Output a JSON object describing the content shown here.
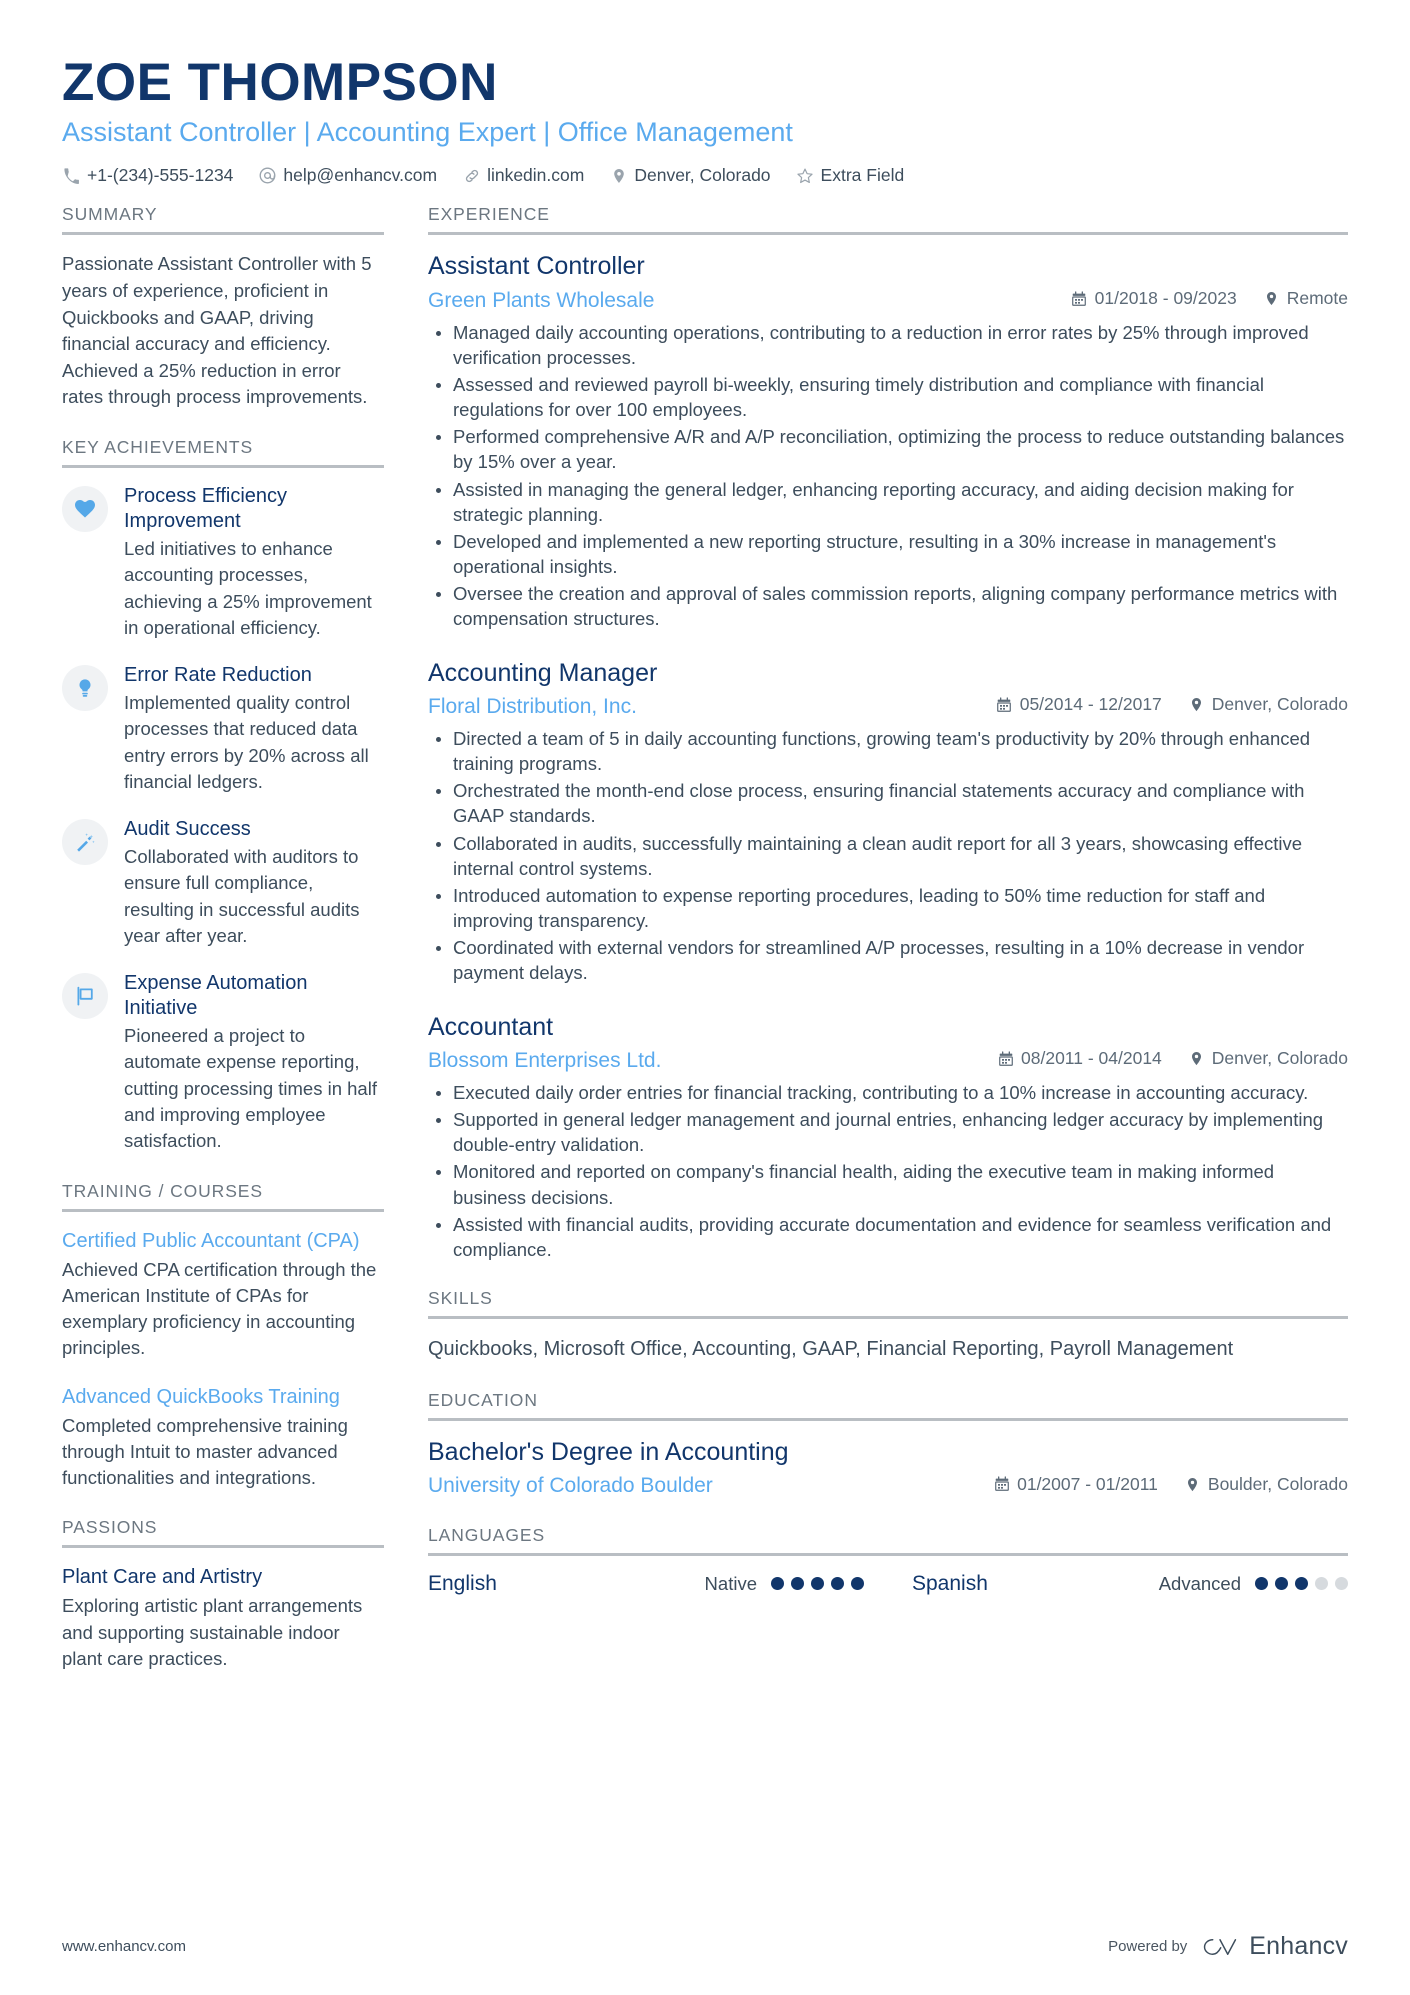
{
  "header": {
    "name": "ZOE THOMPSON",
    "headline": "Assistant Controller | Accounting Expert | Office Management",
    "contacts": [
      {
        "icon": "phone-icon",
        "text": "+1-(234)-555-1234"
      },
      {
        "icon": "email-icon",
        "text": "help@enhancv.com"
      },
      {
        "icon": "link-icon",
        "text": "linkedin.com"
      },
      {
        "icon": "location-pin-icon",
        "text": "Denver, Colorado"
      },
      {
        "icon": "star-icon",
        "text": "Extra Field"
      }
    ]
  },
  "sidebar": {
    "summary": {
      "title": "SUMMARY",
      "text": "Passionate Assistant Controller with 5 years of experience, proficient in Quickbooks and GAAP, driving financial accuracy and efficiency. Achieved a 25% reduction in error rates through process improvements."
    },
    "key_achievements": {
      "title": "KEY ACHIEVEMENTS",
      "items": [
        {
          "icon": "heart-icon",
          "title": "Process Efficiency Improvement",
          "desc": "Led initiatives to enhance accounting processes, achieving a 25% improvement in operational efficiency."
        },
        {
          "icon": "lightbulb-icon",
          "title": "Error Rate Reduction",
          "desc": "Implemented quality control processes that reduced data entry errors by 20% across all financial ledgers."
        },
        {
          "icon": "magic-wand-icon",
          "title": "Audit Success",
          "desc": "Collaborated with auditors to ensure full compliance, resulting in successful audits year after year."
        },
        {
          "icon": "flag-icon",
          "title": "Expense Automation Initiative",
          "desc": "Pioneered a project to automate expense reporting, cutting processing times in half and improving employee satisfaction."
        }
      ]
    },
    "training": {
      "title": "TRAINING / COURSES",
      "items": [
        {
          "title": "Certified Public Accountant (CPA)",
          "desc": "Achieved CPA certification through the American Institute of CPAs for exemplary proficiency in accounting principles."
        },
        {
          "title": "Advanced QuickBooks Training",
          "desc": "Completed comprehensive training through Intuit to master advanced functionalities and integrations."
        }
      ]
    },
    "passions": {
      "title": "PASSIONS",
      "items": [
        {
          "title": "Plant Care and Artistry",
          "desc": "Exploring artistic plant arrangements and supporting sustainable indoor plant care practices."
        }
      ]
    }
  },
  "main": {
    "experience": {
      "title": "EXPERIENCE",
      "jobs": [
        {
          "title": "Assistant Controller",
          "company": "Green Plants Wholesale",
          "dates": "01/2018 - 09/2023",
          "location": "Remote",
          "bullets": [
            "Managed daily accounting operations, contributing to a reduction in error rates by 25% through improved verification processes.",
            "Assessed and reviewed payroll bi-weekly, ensuring timely distribution and compliance with financial regulations for over 100 employees.",
            "Performed comprehensive A/R and A/P reconciliation, optimizing the process to reduce outstanding balances by 15% over a year.",
            "Assisted in managing the general ledger, enhancing reporting accuracy, and aiding decision making for strategic planning.",
            "Developed and implemented a new reporting structure, resulting in a 30% increase in management's operational insights.",
            "Oversee the creation and approval of sales commission reports, aligning company performance metrics with compensation structures."
          ]
        },
        {
          "title": "Accounting Manager",
          "company": "Floral Distribution, Inc.",
          "dates": "05/2014 - 12/2017",
          "location": "Denver, Colorado",
          "bullets": [
            "Directed a team of 5 in daily accounting functions, growing team's productivity by 20% through enhanced training programs.",
            "Orchestrated the month-end close process, ensuring financial statements accuracy and compliance with GAAP standards.",
            "Collaborated in audits, successfully maintaining a clean audit report for all 3 years, showcasing effective internal control systems.",
            "Introduced automation to expense reporting procedures, leading to 50% time reduction for staff and improving transparency.",
            "Coordinated with external vendors for streamlined A/P processes, resulting in a 10% decrease in vendor payment delays."
          ]
        },
        {
          "title": "Accountant",
          "company": "Blossom Enterprises Ltd.",
          "dates": "08/2011 - 04/2014",
          "location": "Denver, Colorado",
          "bullets": [
            "Executed daily order entries for financial tracking, contributing to a 10% increase in accounting accuracy.",
            "Supported in general ledger management and journal entries, enhancing ledger accuracy by implementing double-entry validation.",
            "Monitored and reported on company's financial health, aiding the executive team in making informed business decisions.",
            "Assisted with financial audits, providing accurate documentation and evidence for seamless verification and compliance."
          ]
        }
      ]
    },
    "skills": {
      "title": "SKILLS",
      "text": "Quickbooks, Microsoft Office, Accounting, GAAP, Financial Reporting, Payroll Management"
    },
    "education": {
      "title": "EDUCATION",
      "items": [
        {
          "degree": "Bachelor's Degree in Accounting",
          "school": "University of Colorado Boulder",
          "dates": "01/2007 - 01/2011",
          "location": "Boulder, Colorado"
        }
      ]
    },
    "languages": {
      "title": "LANGUAGES",
      "items": [
        {
          "name": "English",
          "level": "Native",
          "rating": 5,
          "max": 5
        },
        {
          "name": "Spanish",
          "level": "Advanced",
          "rating": 3,
          "max": 5
        }
      ]
    }
  },
  "footer": {
    "url": "www.enhancv.com",
    "powered_by": "Powered by",
    "brand": "Enhancv"
  },
  "colors": {
    "navy": "#11366b",
    "light_blue": "#5aaaee",
    "body_text": "#3d4d5c",
    "heading_gray": "#6c7781",
    "rule_gray": "#b9bec3",
    "badge_bg": "#f0f2f4"
  }
}
